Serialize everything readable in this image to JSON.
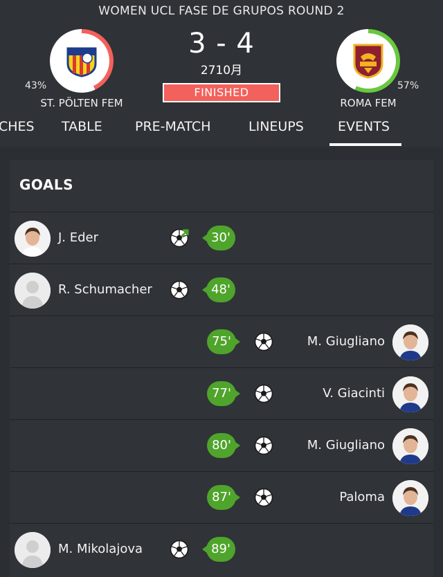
{
  "header": {
    "league": "WOMEN UCL  FASE DE GRUPOS ROUND 2",
    "score": "3 - 4",
    "date": "2710月",
    "status": "FINISHED",
    "home": {
      "name": "ST. PÖLTEN FEM",
      "possession": "43%",
      "ring_color": "#f2615c",
      "ring_fraction": 0.43
    },
    "away": {
      "name": "ROMA FEM",
      "possession": "57%",
      "ring_color": "#6ac840",
      "ring_fraction": 0.57
    }
  },
  "tabs": [
    "CHES",
    "TABLE",
    "PRE-MATCH",
    "LINEUPS",
    "EVENTS"
  ],
  "active_tab": "EVENTS",
  "goals": {
    "title": "GOALS",
    "events": [
      {
        "side": "home",
        "player": "J. Eder",
        "minute": "30'",
        "icon": "soccer-ball-penalty-icon"
      },
      {
        "side": "home",
        "player": "R. Schumacher",
        "minute": "48'",
        "icon": "soccer-ball-icon"
      },
      {
        "side": "away",
        "player": "M. Giugliano",
        "minute": "75'",
        "icon": "soccer-ball-icon"
      },
      {
        "side": "away",
        "player": "V. Giacinti",
        "minute": "77'",
        "icon": "soccer-ball-icon"
      },
      {
        "side": "away",
        "player": "M. Giugliano",
        "minute": "80'",
        "icon": "soccer-ball-icon"
      },
      {
        "side": "away",
        "player": "Paloma",
        "minute": "87'",
        "icon": "soccer-ball-icon"
      },
      {
        "side": "home",
        "player": "M. Mikolajova",
        "minute": "89'",
        "icon": "soccer-ball-icon"
      }
    ]
  },
  "colors": {
    "minute_badge": "#4fa42b",
    "status_bg": "#f2615c"
  }
}
